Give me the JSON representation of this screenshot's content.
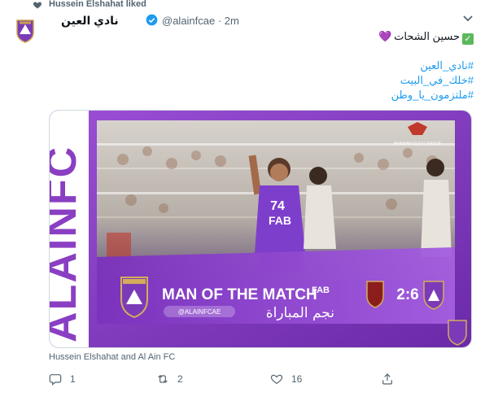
{
  "liked_by": "Hussein Elshahat liked",
  "account": {
    "display_name": "نادي العين",
    "handle": "@alainfcae · 2m",
    "avatar_icon": "al-ain-fc-logo"
  },
  "tweet": {
    "line1": "حسين الشحات",
    "hashtags": [
      "#نادي_العين",
      "#خلك_في_البيت",
      "#ملتزمون_يا_وطن"
    ]
  },
  "media": {
    "side_text": "ALAINFC",
    "title": "MAN OF THE MATCH",
    "subtitle_ar": "نجم المباراة",
    "score": "2:6",
    "social_handle": "@ALAINFCAE",
    "jersey_number": "74",
    "sponsor": "FAB",
    "league_label": "ARABIAN GULF LEAGUE",
    "colors": {
      "purple": "#8a3fc3",
      "dark_purple": "#5b1f8f",
      "white": "#ffffff"
    }
  },
  "credit": "Hussein Elshahat and Al Ain FC",
  "actions": {
    "reply_count": "1",
    "retweet_count": "2",
    "like_count": "16"
  }
}
